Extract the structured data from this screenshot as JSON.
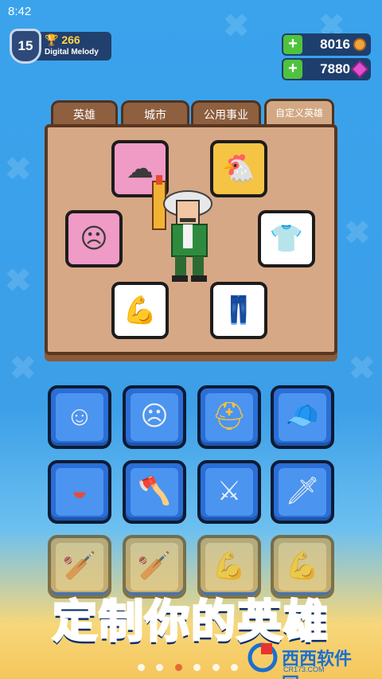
{
  "status": {
    "time": "8:42"
  },
  "player": {
    "level": "15",
    "trophies": "266",
    "name": "Digital Melody"
  },
  "currencies": [
    {
      "value": "8016",
      "icon": "coin-icon"
    },
    {
      "value": "7880",
      "icon": "gem-icon"
    }
  ],
  "tabs": [
    {
      "label": "英雄",
      "active": false
    },
    {
      "label": "城市",
      "active": false
    },
    {
      "label": "公用事业",
      "active": false
    },
    {
      "label": "自定义英雄",
      "active": true
    }
  ],
  "banner": {
    "text": "定制你的英雄"
  },
  "watermark": {
    "text": "西西软件园",
    "sub": "CR173.COM"
  },
  "pagination": {
    "count": 6,
    "active": 3
  }
}
